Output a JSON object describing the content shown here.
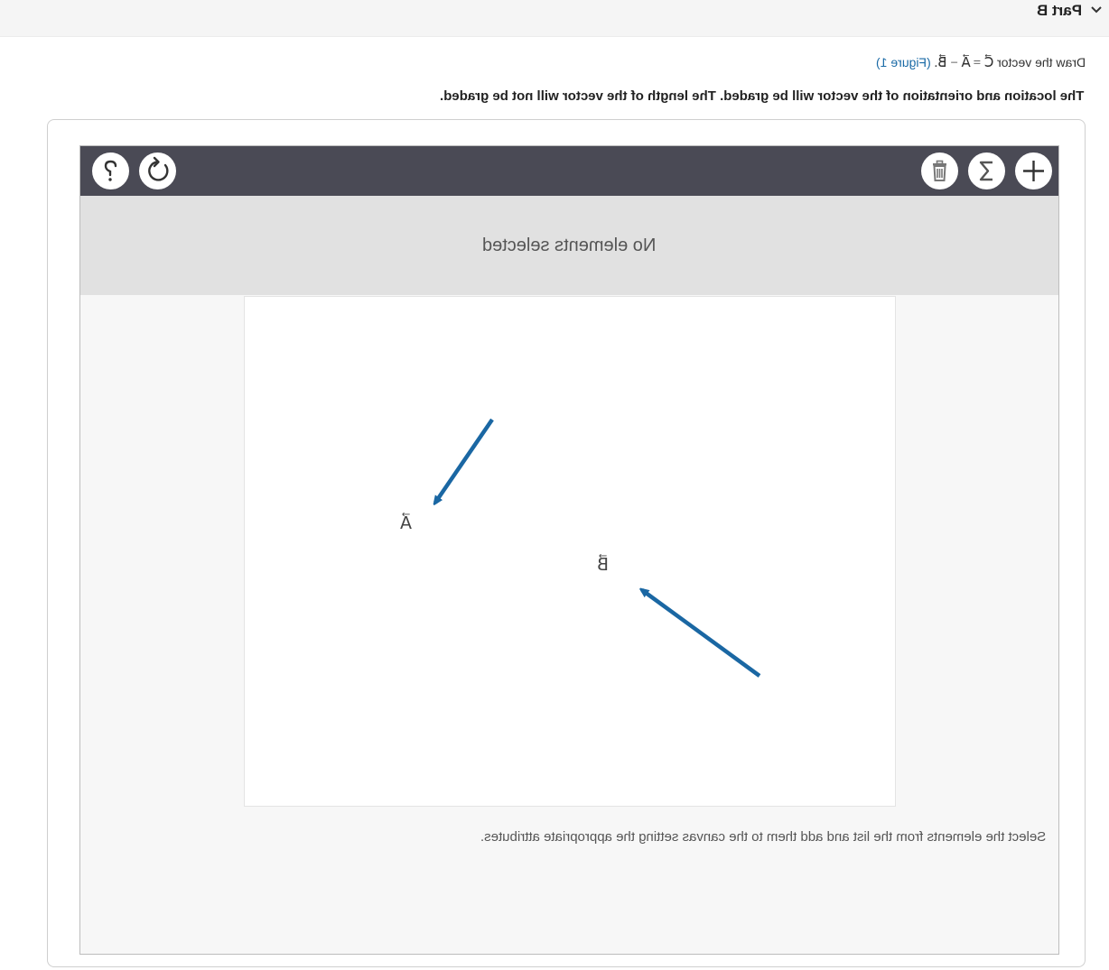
{
  "part": {
    "title": "Part B"
  },
  "prompt": {
    "lead": "Draw the vector",
    "equation": "C⃗ = A⃗ − B⃗.",
    "figure_link": "(Figure 1)"
  },
  "instruction": "The location and orientation of the vector will be graded. The length of the vector will not be graded.",
  "toolbar": {
    "right_tools": [
      "add-icon",
      "sum-icon",
      "trash-icon"
    ],
    "left_tools": [
      "reset-icon",
      "help-icon"
    ]
  },
  "status": {
    "text": "No elements selected"
  },
  "canvas": {
    "vectors": [
      {
        "label": "A⃗",
        "color": "#1a67a3"
      },
      {
        "label": "B⃗",
        "color": "#1a67a3"
      }
    ]
  },
  "hint": "Select the elements from the list and add them to the canvas setting the appropriate attributes.",
  "colors": {
    "toolbar": "#4a4a55",
    "vector": "#1a67a3",
    "link": "#1a6aa6"
  }
}
